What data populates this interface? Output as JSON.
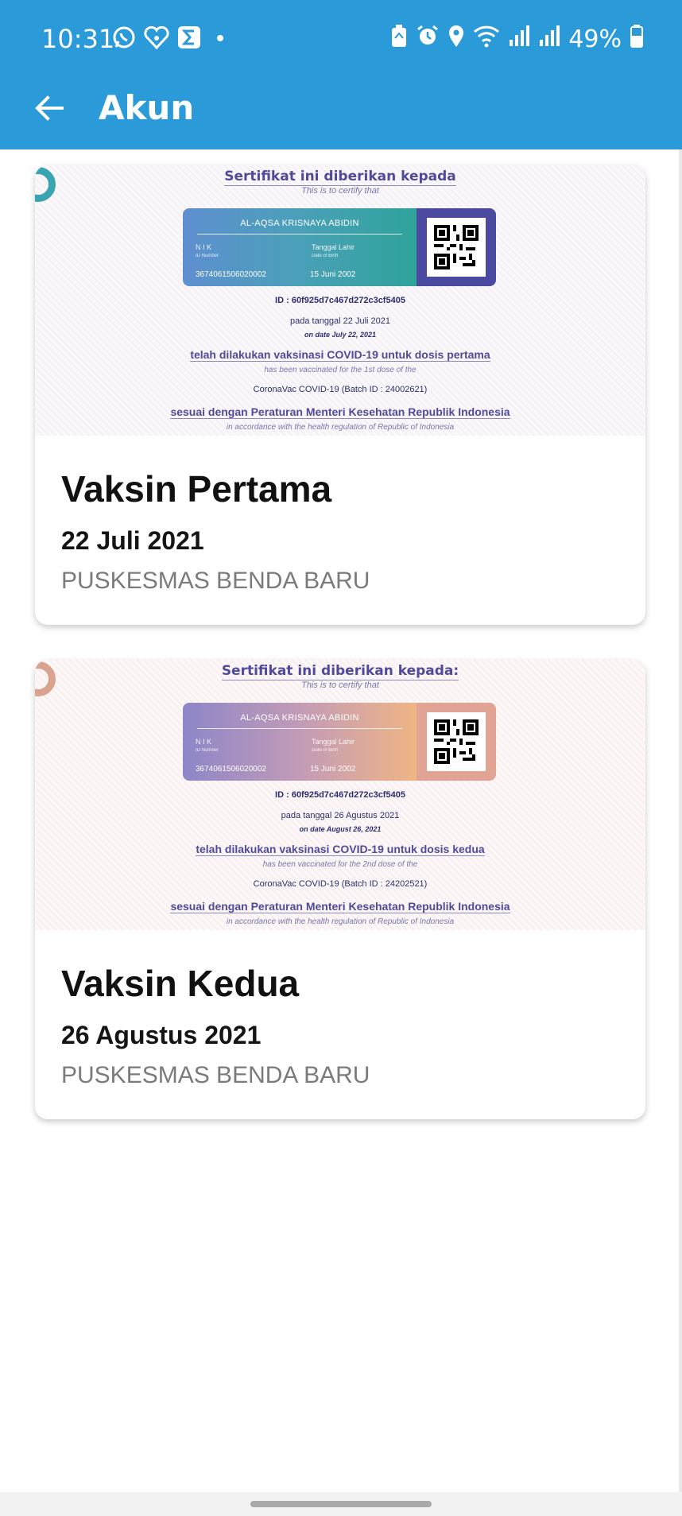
{
  "status_bar": {
    "time": "10:31",
    "battery": "49%",
    "icons_left": [
      "whatsapp-icon",
      "heart-app-icon",
      "sigma-app-icon",
      "dot-icon"
    ],
    "icons_right": [
      "battery-saver-icon",
      "alarm-icon",
      "location-icon",
      "wifi-icon",
      "signal-icon",
      "signal-icon",
      "battery-icon"
    ]
  },
  "app_bar": {
    "title": "Akun",
    "back_icon": "arrow-left-icon",
    "color": "#2a9ad8"
  },
  "certificates": [
    {
      "cert_title": "Sertifikat ini diberikan kepada",
      "cert_subtitle": "This is to certify that",
      "name": "AL-AQSA KRISNAYA ABIDIN",
      "nik_label": "N I K",
      "nik_sublabel": "ID Number",
      "dob_label": "Tanggal Lahir",
      "dob_sublabel": "Date of Birth",
      "nik_value": "3674061506020002",
      "dob_value": "15 Juni 2002",
      "id_line": "ID : 60f925d7c467d272c3cf5405",
      "date_line": "pada tanggal 22 Juli 2021",
      "date_line_en": "on date July 22, 2021",
      "vaccinated_line": "telah dilakukan vaksinasi COVID-19 untuk dosis pertama",
      "vaccinated_line_en": "has been vaccinated for the 1st dose of the",
      "batch_line": "CoronaVac COVID-19 (Batch ID : 24002621)",
      "regulation_line": "sesuai dengan Peraturan Menteri Kesehatan Republik Indonesia",
      "regulation_line_en": "in accordance with the health regulation of Republic of Indonesia",
      "card_title": "Vaksin Pertama",
      "card_date": "22 Juli 2021",
      "card_place": "PUSKESMAS BENDA BARU"
    },
    {
      "cert_title": "Sertifikat ini diberikan kepada:",
      "cert_subtitle": "This is to certify that",
      "name": "AL-AQSA KRISNAYA ABIDIN",
      "nik_label": "N I K",
      "nik_sublabel": "ID Number",
      "dob_label": "Tanggal Lahir",
      "dob_sublabel": "Date of Birth",
      "nik_value": "3674061506020002",
      "dob_value": "15 Juni 2002",
      "id_line": "ID : 60f925d7c467d272c3cf5405",
      "date_line": "pada tanggal 26 Agustus 2021",
      "date_line_en": "on date August 26, 2021",
      "vaccinated_line": "telah dilakukan vaksinasi COVID-19 untuk dosis kedua",
      "vaccinated_line_en": "has been vaccinated for the 2nd dose of the",
      "batch_line": "CoronaVac COVID-19 (Batch ID : 24202521)",
      "regulation_line": "sesuai dengan Peraturan Menteri Kesehatan Republik Indonesia",
      "regulation_line_en": "in accordance with the health regulation of Republic of Indonesia",
      "card_title": "Vaksin Kedua",
      "card_date": "26 Agustus 2021",
      "card_place": "PUSKESMAS BENDA BARU"
    }
  ]
}
